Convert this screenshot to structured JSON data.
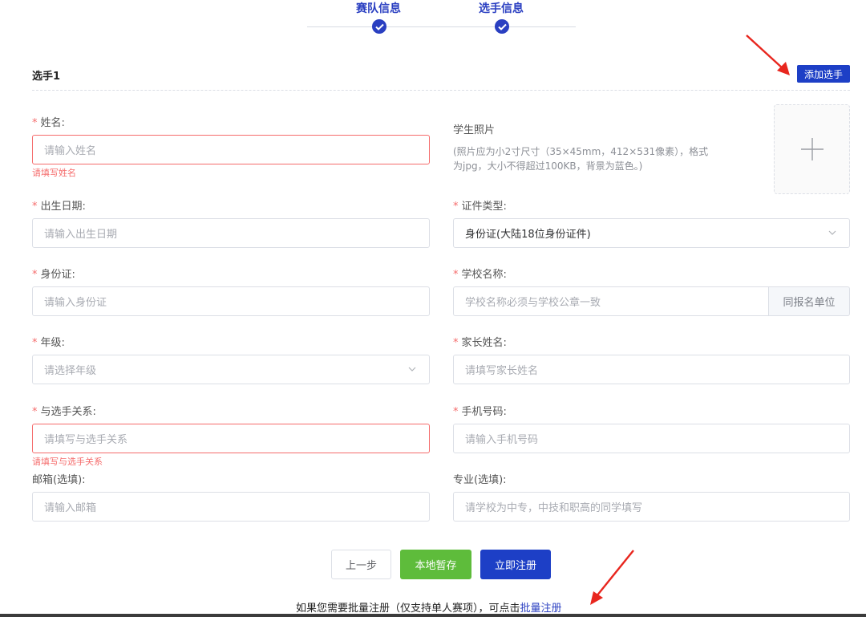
{
  "steps": [
    {
      "label": "赛队信息"
    },
    {
      "label": "选手信息"
    }
  ],
  "section": {
    "title": "选手1",
    "add_button": "添加选手"
  },
  "fields": {
    "name": {
      "label": "姓名:",
      "placeholder": "请输入姓名",
      "error": "请填写姓名"
    },
    "birth": {
      "label": "出生日期:",
      "placeholder": "请输入出生日期"
    },
    "id_card": {
      "label": "身份证:",
      "placeholder": "请输入身份证"
    },
    "grade": {
      "label": "年级:",
      "placeholder": "请选择年级"
    },
    "relation": {
      "label": "与选手关系:",
      "placeholder": "请填写与选手关系",
      "error": "请填写与选手关系"
    },
    "email": {
      "label": "邮箱(选填):",
      "placeholder": "请输入邮箱"
    },
    "id_type": {
      "label": "证件类型:",
      "value": "身份证(大陆18位身份证件)"
    },
    "school": {
      "label": "学校名称:",
      "placeholder": "学校名称必须与学校公章一致",
      "append": "同报名单位"
    },
    "parent": {
      "label": "家长姓名:",
      "placeholder": "请填写家长姓名"
    },
    "phone": {
      "label": "手机号码:",
      "placeholder": "请输入手机号码"
    },
    "major": {
      "label": "专业(选填):",
      "placeholder": "请学校为中专，中技和职高的同学填写"
    }
  },
  "photo": {
    "title": "学生照片",
    "note_line1": "(照片应为小2寸尺寸（35×45mm，412×531像素），格式",
    "note_line2": "为jpg，大小不得超过100KB，背景为蓝色。)"
  },
  "required_mark": "*",
  "buttons": {
    "prev": "上一步",
    "save": "本地暂存",
    "register": "立即注册"
  },
  "bottom": {
    "text": "如果您需要批量注册（仅支持单人赛项），可点击",
    "link": "批量注册"
  },
  "colors": {
    "primary": "#1d3fc6",
    "success": "#5ebc3b",
    "danger": "#f56c6c",
    "annotation_arrow": "#e8261e"
  },
  "icons": {
    "step_done": "check-circle-icon",
    "dropdown": "chevron-down-icon",
    "upload": "plus-icon",
    "annotation": "red-arrow-icon"
  }
}
